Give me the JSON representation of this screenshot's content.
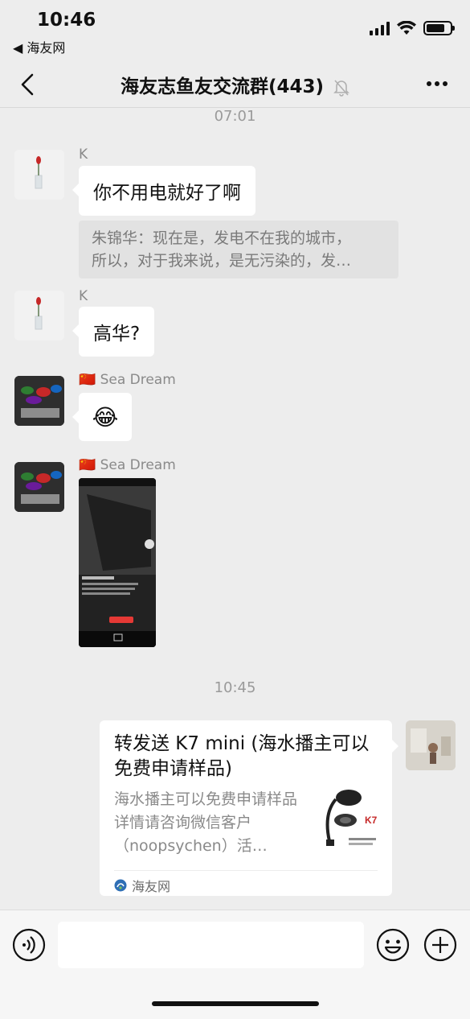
{
  "status_bar": {
    "time": "10:46",
    "back_app": "◀ 海友网",
    "battery_level": 0.8
  },
  "nav": {
    "title": "海友志鱼友交流群(443)"
  },
  "messages": {
    "ts1": "07:01",
    "m1_sender": "K",
    "m1_text": "你不用电就好了啊",
    "m1_quote_line1": "朱锦华：现在是，发电不在我的城市，",
    "m1_quote_line2": "所以，对于我来说，是无污染的，发…",
    "m2_sender": "K",
    "m2_text": "高华?",
    "m3_sender": "🇨🇳 Sea Dream",
    "m3_emoji": "😂",
    "m4_sender": "🇨🇳 Sea Dream",
    "ts2": "10:45"
  },
  "card": {
    "title": "转发送 K7 mini (海水播主可以免费申请样品)",
    "description": "海水播主可以免费申请样品详情请咨询微信客户（noopsychen）活…",
    "source": "海友网",
    "thumb_brand": "K7"
  },
  "input": {
    "placeholder": ""
  }
}
